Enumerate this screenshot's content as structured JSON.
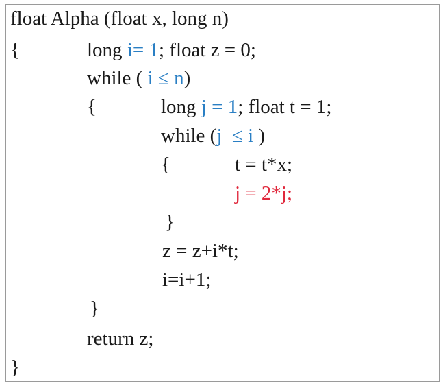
{
  "code": {
    "line1": "float Alpha (float x, long n)",
    "line2_brace": "{",
    "line2_a": "long ",
    "line2_b": "i= 1",
    "line2_c": "; float z = 0;",
    "line3_a": "while ( ",
    "line3_b": "i ≤ n",
    "line3_c": ")",
    "line4_brace": "{",
    "line4_a": "long ",
    "line4_b": "j = 1",
    "line4_c": "; float t = 1;",
    "line5_a": "while (",
    "line5_b": "j  ≤ i ",
    "line5_c": ")",
    "line6_brace": "{",
    "line6_stmt": "t = t*x;",
    "line7_stmt": "j = 2*j;",
    "line8_brace": "}",
    "line9_stmt": "z = z+i*t;",
    "line10_stmt": "i=i+1;",
    "line11_brace": "}",
    "line12_stmt": "return z;",
    "line13_brace": "}"
  },
  "colors": {
    "text": "#1a1a1a",
    "blue": "#2a7fc4",
    "red": "#e0283c",
    "border": "#9a9a9a"
  }
}
